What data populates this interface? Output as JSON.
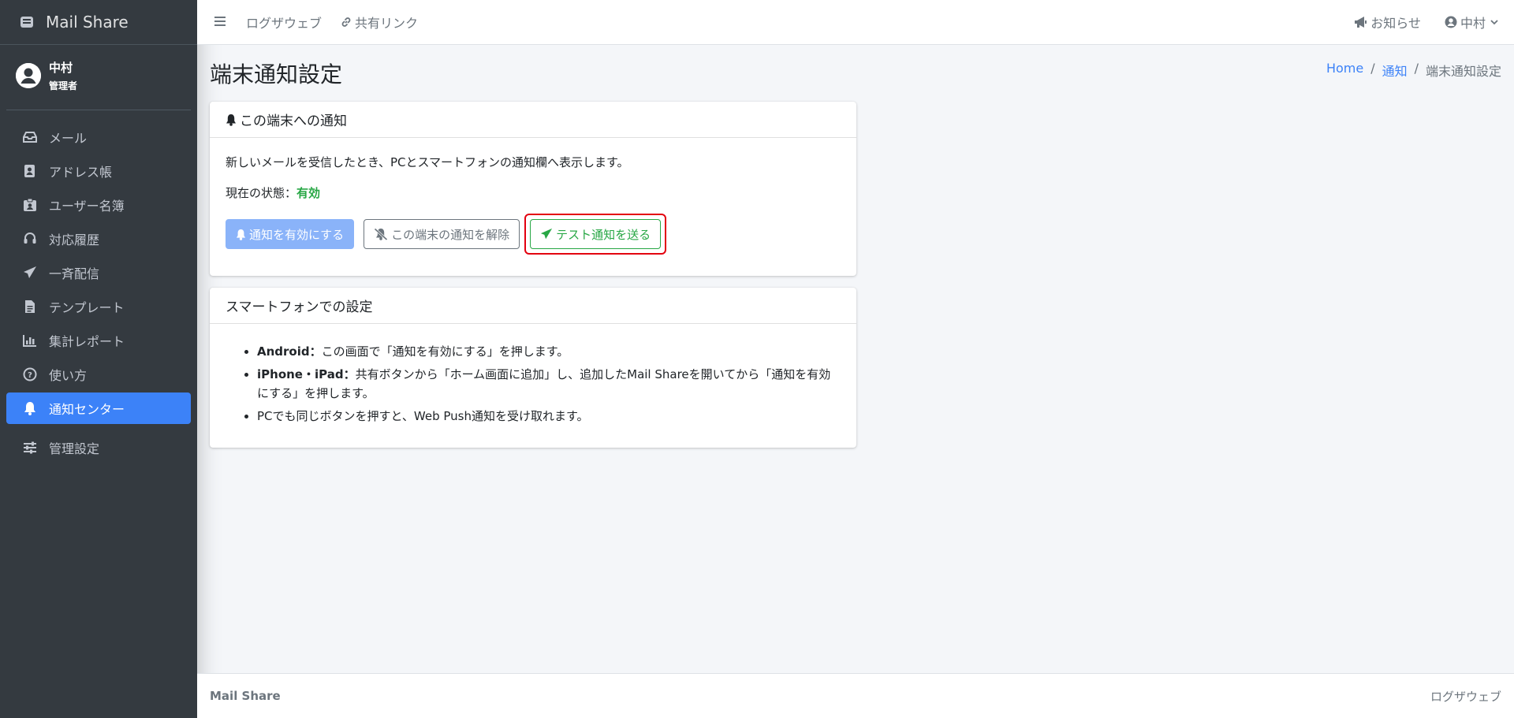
{
  "brand": {
    "name": "Mail Share"
  },
  "user": {
    "name": "中村",
    "role": "管理者"
  },
  "sidebar": {
    "items": [
      {
        "label": "メール",
        "icon": "inbox-icon"
      },
      {
        "label": "アドレス帳",
        "icon": "address-book-icon"
      },
      {
        "label": "ユーザー名簿",
        "icon": "id-badge-icon"
      },
      {
        "label": "対応履歴",
        "icon": "headset-icon"
      },
      {
        "label": "一斉配信",
        "icon": "paper-plane-icon"
      },
      {
        "label": "テンプレート",
        "icon": "file-icon"
      },
      {
        "label": "集計レポート",
        "icon": "bar-chart-icon"
      },
      {
        "label": "使い方",
        "icon": "question-circle-icon"
      },
      {
        "label": "通知センター",
        "icon": "bell-icon",
        "active": true
      },
      {
        "label": "管理設定",
        "icon": "sliders-icon"
      }
    ]
  },
  "topbar": {
    "link1": "ログザウェブ",
    "link2": "共有リンク",
    "notice": "お知らせ",
    "user": "中村"
  },
  "page": {
    "title": "端末通知設定",
    "breadcrumb": [
      "Home",
      "通知",
      "端末通知設定"
    ]
  },
  "card1": {
    "header": "この端末への通知",
    "desc": "新しいメールを受信したとき、PCとスマートフォンの通知欄へ表示します。",
    "status_label": "現在の状態：",
    "status_value": "有効",
    "btn_enable": "通知を有効にする",
    "btn_disable": "この端末の通知を解除",
    "btn_test": "テスト通知を送る"
  },
  "card2": {
    "header": "スマートフォンでの設定",
    "tips": [
      {
        "bold": "Android：",
        "text": "この画面で「通知を有効にする」を押します。"
      },
      {
        "bold": "iPhone・iPad：",
        "text": "共有ボタンから「ホーム画面に追加」し、追加したMail Shareを開いてから「通知を有効にする」を押します。"
      },
      {
        "bold": "",
        "text": "PCでも同じボタンを押すと、Web Push通知を受け取れます。"
      }
    ]
  },
  "footer": {
    "left": "Mail Share",
    "right": "ログザウェブ"
  },
  "colors": {
    "accent": "#3c82f8",
    "sidebar": "#343a40",
    "success": "#28a745",
    "highlight": "#e3000f"
  }
}
